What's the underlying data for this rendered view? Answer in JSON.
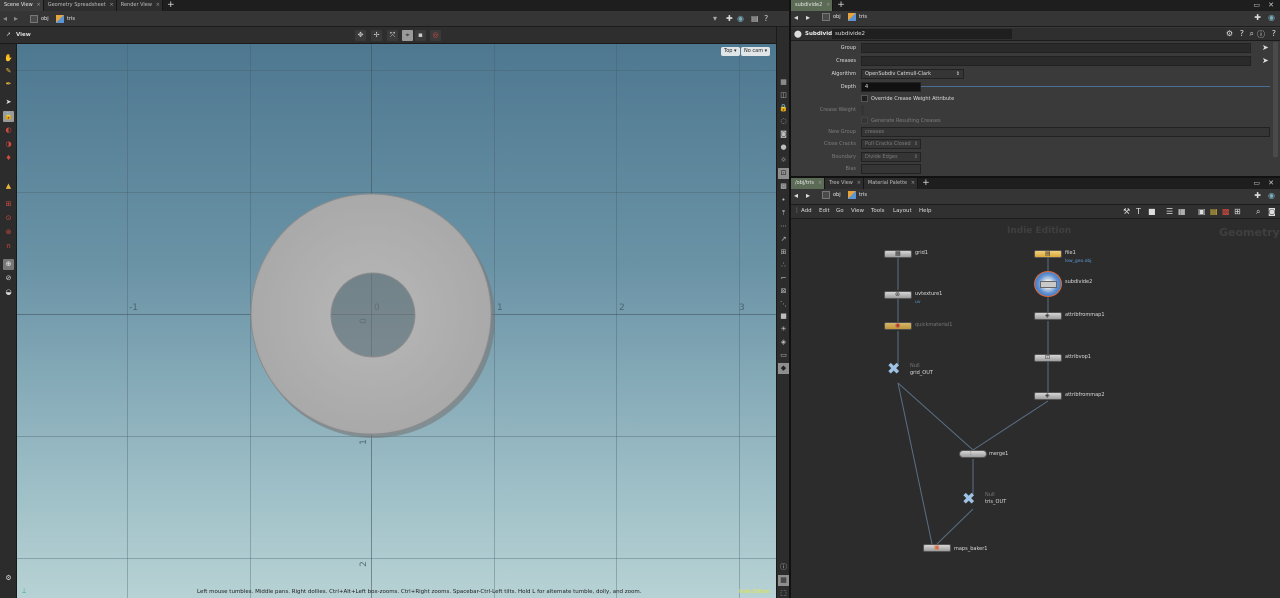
{
  "left": {
    "tabs": [
      "Scene View",
      "Geometry Spreadsheet",
      "Render View"
    ],
    "path": [
      "obj",
      "tris"
    ],
    "view_title": "View",
    "camera": [
      "Top",
      "No cam"
    ],
    "axis_labels_x": [
      "-2",
      "-1",
      "0",
      "1",
      "2",
      "3"
    ],
    "axis_labels_y": [
      "0",
      "1",
      "2"
    ],
    "status": "Left mouse tumbles. Middle pans. Right dollies. Ctrl+Alt+Left box-zooms. Ctrl+Right zooms. Spacebar-Ctrl-Left tilts. Hold L for alternate tumble, dolly, and zoom.",
    "indie": "Indie Edition"
  },
  "params": {
    "tabs": [
      "subdivide2"
    ],
    "path": [
      "obj",
      "tris"
    ],
    "node_type": "Subdivide",
    "node_name": "subdivide2",
    "rows": [
      {
        "label": "Group",
        "value": ""
      },
      {
        "label": "Creases",
        "value": ""
      },
      {
        "label": "Algorithm",
        "value": "OpenSubdiv Catmull-Clark"
      },
      {
        "label": "Depth",
        "value": "4"
      },
      {
        "label": "Override Crease Weight Attribute"
      },
      {
        "label": "Crease Weight",
        "value": ""
      },
      {
        "label": "Generate Resulting Creases"
      },
      {
        "label": "New Group",
        "value": "creases"
      },
      {
        "label": "Close Cracks",
        "value": "Pull Cracks Closed"
      },
      {
        "label": "Boundary",
        "value": "Divide Edges"
      },
      {
        "label": "Bias",
        "value": ""
      }
    ]
  },
  "network": {
    "tabs": [
      "/obj/tris",
      "Tree View",
      "Material Palette"
    ],
    "path": [
      "obj",
      "tris"
    ],
    "menu": [
      "Add",
      "Edit",
      "Go",
      "View",
      "Tools",
      "Layout",
      "Help"
    ],
    "watermark_left": "Indie Edition",
    "watermark_right": "Geometry",
    "nodes": {
      "grid1": "grid1",
      "uvtexture1": "uvtexture1",
      "uvtexture1_sub": "uv",
      "quickmaterial1": "quickmaterial1",
      "grid_out": "grid_OUT",
      "grid_out_tag": "Null",
      "file1": "file1",
      "file1_sub": "low_geo.obj",
      "subdivide2": "subdivide2",
      "attribfrommap1": "attribfrommap1",
      "attribvop1": "attribvop1",
      "attribfrommap2": "attribfrommap2",
      "merge1": "merge1",
      "tris_out": "tris_OUT",
      "tris_out_tag": "Null",
      "maps_baker1": "maps_baker1"
    }
  }
}
